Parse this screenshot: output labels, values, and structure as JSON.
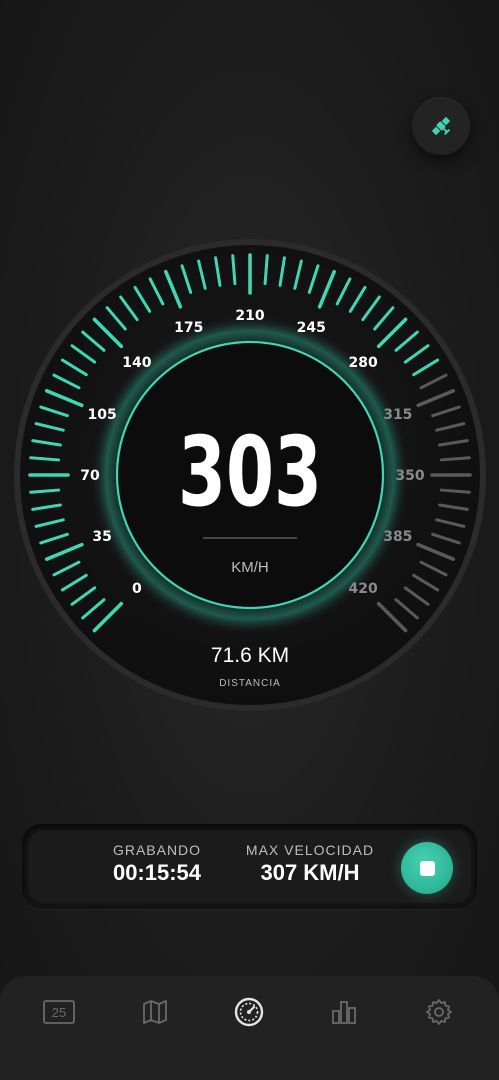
{
  "speed": {
    "value": "303",
    "unit": "KM/H",
    "distance_value": "71.6 KM",
    "distance_label": "DISTANCIA",
    "scale_labels": [
      "0",
      "35",
      "70",
      "105",
      "140",
      "175",
      "210",
      "245",
      "280",
      "315",
      "350",
      "385",
      "420"
    ],
    "scale_max": 420,
    "current": 303
  },
  "status": {
    "recording_label": "GRABANDO",
    "recording_time": "00:15:54",
    "max_speed_label": "MAX VELOCIDAD",
    "max_speed_value": "307 KM/H"
  },
  "nav": {
    "calendar_badge": "25"
  },
  "colors": {
    "accent": "#3ed6b5",
    "inactive_tick": "#5a5a5a",
    "background": "#1c1c1c"
  },
  "icons": {
    "top_button": "satellite-icon",
    "stop": "stop-icon",
    "nav": [
      "calendar-icon",
      "map-icon",
      "speedometer-icon",
      "bar-chart-icon",
      "gear-icon"
    ]
  }
}
